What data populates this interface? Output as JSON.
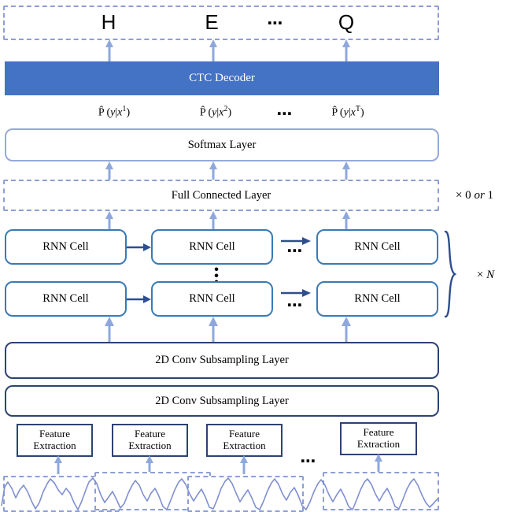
{
  "diagram": {
    "title": "CTC-based speech recognition architecture",
    "colors": {
      "accent_fill": "#4472C4",
      "dashed_border": "#8C9ED4",
      "soft_border": "#96AADA",
      "rnn_border": "#3A7AB5",
      "conv_border": "#2C4372",
      "arrow_light": "#8FA8DC",
      "arrow_dark": "#2E4E8F",
      "waveform": "#7F8FD0",
      "background": "#FFFFFF"
    },
    "output_tokens": {
      "name": "output-sequence",
      "items": [
        "H",
        "E",
        "Q"
      ],
      "ellipsis": "⋯"
    },
    "ctc_decoder": {
      "label": "CTC Decoder"
    },
    "probabilities": {
      "items": [
        {
          "hat": "P̂",
          "body": "(y|x",
          "sup": "1",
          "close": ")"
        },
        {
          "hat": "P̂",
          "body": "(y|x",
          "sup": "2",
          "close": ")"
        },
        {
          "hat": "P̂",
          "body": "(y|x",
          "sup": "T",
          "close": ")"
        }
      ],
      "ellipsis": "⋯"
    },
    "softmax_layer": {
      "label": "Softmax Layer"
    },
    "full_connected_layer": {
      "label": "Full Connected Layer",
      "multiplier_prefix": "× 0 ",
      "multiplier_italic": "or",
      "multiplier_suffix": " 1"
    },
    "rnn_rows": [
      {
        "cells": [
          "RNN Cell",
          "RNN Cell",
          "RNN Cell"
        ]
      },
      {
        "cells": [
          "RNN Cell",
          "RNN Cell",
          "RNN Cell"
        ]
      }
    ],
    "rnn_multiplier": {
      "prefix": "× ",
      "italic": "N"
    },
    "rnn_vertical_ellipsis": "⋮",
    "rnn_horizontal_ellipsis": "⋯",
    "conv_layers": [
      {
        "label": "2D Conv Subsampling Layer"
      },
      {
        "label": "2D Conv Subsampling Layer"
      }
    ],
    "feature_extraction": {
      "boxes": [
        {
          "line1": "Feature",
          "line2": "Extraction"
        },
        {
          "line1": "Feature",
          "line2": "Extraction"
        },
        {
          "line1": "Feature",
          "line2": "Extraction"
        },
        {
          "line1": "Feature",
          "line2": "Extraction"
        }
      ],
      "ellipsis": "⋯"
    },
    "waveform": {
      "name": "audio-waveform",
      "window_count": 4
    }
  }
}
